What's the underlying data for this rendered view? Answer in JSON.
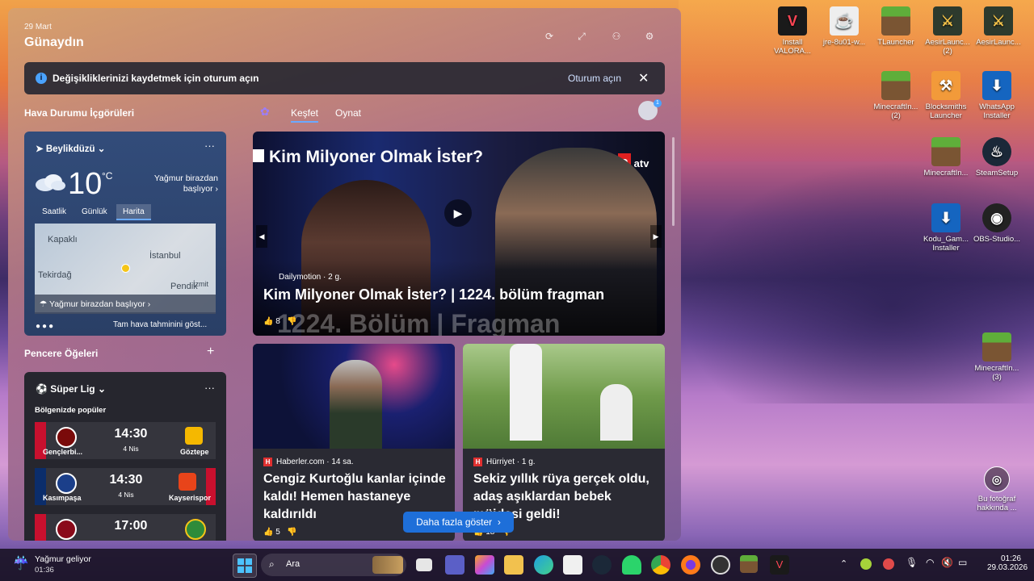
{
  "panel": {
    "date": "29 Mart",
    "greeting": "Günaydın",
    "banner": {
      "message": "Değişikliklerinizi kaydetmek için oturum açın",
      "signin": "Oturum açın"
    },
    "weather_section_title": "Hava Durumu İçgörüleri",
    "tabs": [
      "Keşfet",
      "Oynat"
    ],
    "weather": {
      "location": "Beylikdüzü",
      "temp": "10",
      "unit": "°C",
      "rain_note": "Yağmur birazdan başlıyor",
      "tabs": [
        "Saatlik",
        "Günlük",
        "Harita"
      ],
      "map_labels": [
        "Kapaklı",
        "İstanbul",
        "Tekirdağ",
        "Pendik",
        "İzmit"
      ],
      "map_bar": "Yağmur birazdan başlıyor",
      "footer": "Tam hava tahminini göst..."
    },
    "widgets_title": "Pencere Öğeleri",
    "sports": {
      "league": "Süper Lig",
      "subtitle": "Bölgenizde popüler",
      "matches": [
        {
          "home": "Gençlerbi...",
          "away": "Göztepe",
          "time": "14:30",
          "date": "4 Nis"
        },
        {
          "home": "Kasımpaşa",
          "away": "Kayserispor",
          "time": "14:30",
          "date": "4 Nis"
        },
        {
          "home": "",
          "away": "",
          "time": "17:00",
          "date": ""
        }
      ]
    },
    "hero": {
      "overlay_title": "Kim Milyoner Olmak İster?",
      "channel": "atv",
      "source": "Dailymotion",
      "age": "2 g.",
      "title": "Kim Milyoner Olmak İster? | 1224. bölüm fragman",
      "caption": "1224. Bölüm | Fragman",
      "likes": "8"
    },
    "news": [
      {
        "source": "Haberler.com",
        "age": "14 sa.",
        "title": "Cengiz Kurtoğlu kanlar içinde kaldı! Hemen hastaneye kaldırıldı",
        "likes": "5"
      },
      {
        "source": "Hürriyet",
        "age": "1 g.",
        "title": "Sekiz yıllık rüya gerçek oldu, adaş aşıklardan bebek müjdesi geldi!",
        "likes": "18"
      }
    ],
    "more_button": "Daha fazla göster"
  },
  "desktop_icons": [
    {
      "label": "Install VALORA...",
      "icon": "valorant-icon"
    },
    {
      "label": "jre-8u01-w...",
      "icon": "java-icon"
    },
    {
      "label": "TLauncher",
      "icon": "minecraft-icon"
    },
    {
      "label": "AesirLaunc... (2)",
      "icon": "viking-icon"
    },
    {
      "label": "AesirLaunc...",
      "icon": "viking-icon"
    },
    {
      "label": "MinecraftIn... (2)",
      "icon": "minecraft-icon"
    },
    {
      "label": "Blocksmiths Launcher",
      "icon": "hammer-icon"
    },
    {
      "label": "WhatsApp Installer",
      "icon": "download-icon"
    },
    {
      "label": "MinecraftIn...",
      "icon": "minecraft-icon"
    },
    {
      "label": "SteamSetup",
      "icon": "steam-icon"
    },
    {
      "label": "Kodu_Gam... Installer",
      "icon": "download-icon"
    },
    {
      "label": "OBS-Studio...",
      "icon": "obs-icon"
    },
    {
      "label": "MinecraftIn... (3)",
      "icon": "minecraft-icon"
    },
    {
      "label": "Bu fotoğraf hakkında ...",
      "icon": "camera-icon"
    }
  ],
  "taskbar": {
    "weather_title": "Yağmur geliyor",
    "weather_time": "01:36",
    "search_placeholder": "Ara",
    "clock_time": "01:26",
    "clock_date": "29.03.2026"
  },
  "colors": {
    "accent": "#1e6fd9",
    "banner": "#2a2a33",
    "weather_card": "#324c7a"
  }
}
